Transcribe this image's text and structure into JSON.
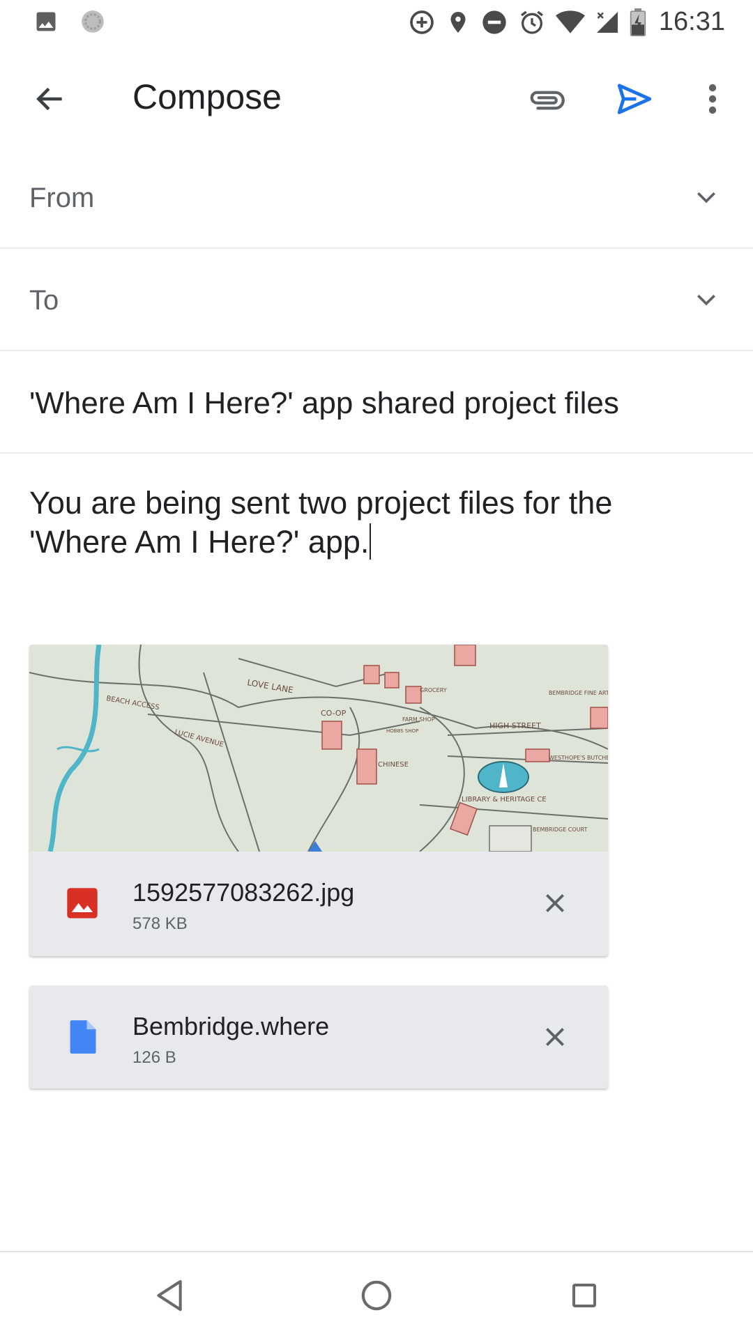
{
  "status_bar": {
    "time": "16:31",
    "icons": [
      "gallery-notification-icon",
      "sync-notification-icon",
      "data-saver-icon",
      "location-icon",
      "do-not-disturb-icon",
      "alarm-icon",
      "wifi-icon",
      "mobile-signal-icon",
      "battery-charging-icon"
    ]
  },
  "app_bar": {
    "title": "Compose",
    "icons": [
      "back-arrow-icon",
      "paperclip-icon",
      "send-icon",
      "more-vert-icon"
    ],
    "send_color": "#1a73e8"
  },
  "form": {
    "from_label": "From",
    "to_label": "To",
    "subject": "'Where Am I Here?' app shared project files",
    "body_line1": "You are being sent two project files for the",
    "body_line2": "'Where Am I Here?' app."
  },
  "attachments": [
    {
      "name": "1592577083262.jpg",
      "size": "578 KB",
      "icon": "image-file-icon",
      "icon_color": "#d93025",
      "thumbnail_labels": {
        "love_lane": "LOVE LANE",
        "beach_access": "BEACH ACCESS",
        "coop": "CO-OP",
        "high_street": "HIGH STREET",
        "chinese": "CHINESE",
        "library": "LIBRARY & HERITAGE CE",
        "bembridge_fine_art": "BEMBRIDGE FINE ART",
        "butcher": "WESTHOPE'S BUTCHER",
        "bembridge_court": "BEMBRIDGE COURT",
        "lucie_avenue": "LUCIE AVENUE",
        "grocery": "GROCERY",
        "farm_shop": "FARM SHOP",
        "hobbs_shop": "HOBBS SHOP"
      }
    },
    {
      "name": "Bembridge.where",
      "size": "126 B",
      "icon": "document-file-icon",
      "icon_color": "#4285f4"
    }
  ],
  "nav_bar": {
    "icons": [
      "nav-back-icon",
      "nav-home-icon",
      "nav-recents-icon"
    ]
  }
}
